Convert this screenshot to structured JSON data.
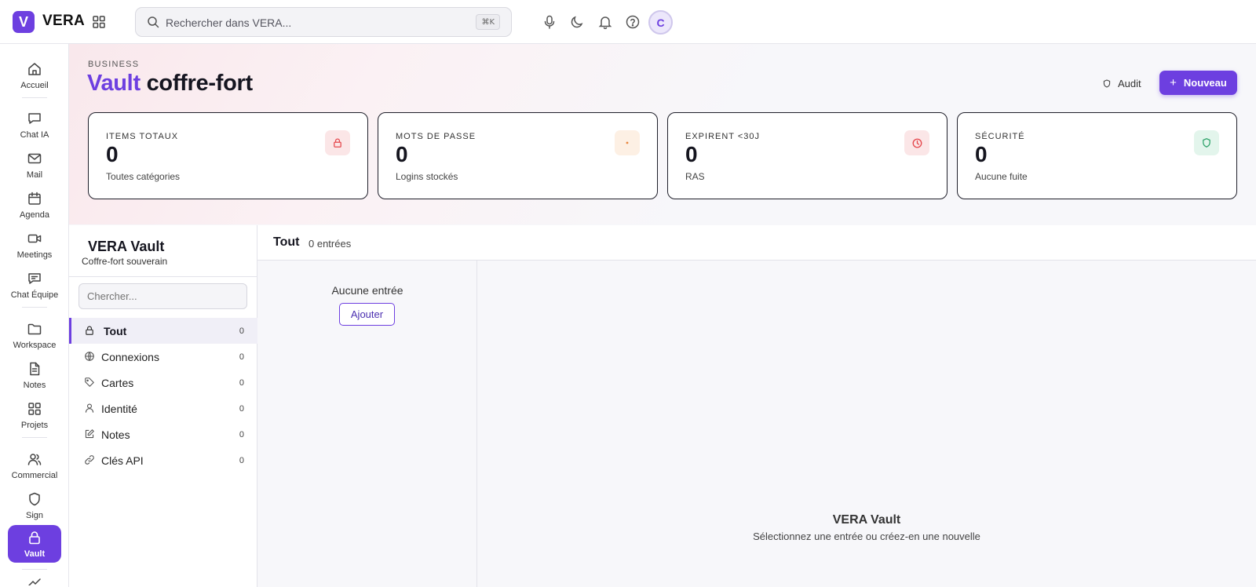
{
  "app": {
    "logo_letter": "V",
    "name": "VERA"
  },
  "search": {
    "placeholder": "Rechercher dans VERA...",
    "shortcut": "⌘K"
  },
  "user": {
    "initial": "C"
  },
  "rail": {
    "items": [
      {
        "label": "Accueil",
        "icon": "home-icon"
      },
      {
        "label": "Chat IA",
        "icon": "chat-icon"
      },
      {
        "label": "Mail",
        "icon": "mail-icon"
      },
      {
        "label": "Agenda",
        "icon": "calendar-icon"
      },
      {
        "label": "Meetings",
        "icon": "video-icon"
      },
      {
        "label": "Chat Équipe",
        "icon": "team-chat-icon"
      },
      {
        "label": "Workspace",
        "icon": "folder-icon"
      },
      {
        "label": "Notes",
        "icon": "file-icon"
      },
      {
        "label": "Projets",
        "icon": "grid-icon"
      },
      {
        "label": "Commercial",
        "icon": "users-icon"
      },
      {
        "label": "Sign",
        "icon": "shield-icon"
      },
      {
        "label": "Vault",
        "icon": "lock-icon"
      }
    ],
    "active": "Vault"
  },
  "header": {
    "eyebrow": "BUSINESS",
    "title_accent": "Vault",
    "title_rest": "coffre-fort",
    "audit_label": "Audit",
    "new_label": "Nouveau"
  },
  "stats": [
    {
      "label": "ITEMS TOTAUX",
      "value": "0",
      "sub": "Toutes catégories",
      "icon": "lock-icon",
      "color": "#e5484d"
    },
    {
      "label": "MOTS DE PASSE",
      "value": "0",
      "sub": "Logins stockés",
      "icon": "dot-icon",
      "color": "#e8853d"
    },
    {
      "label": "EXPIRENT <30J",
      "value": "0",
      "sub": "RAS",
      "icon": "clock-icon",
      "color": "#e5484d"
    },
    {
      "label": "SÉCURITÉ",
      "value": "0",
      "sub": "Aucune fuite",
      "icon": "shield-icon",
      "color": "#2fa36b"
    }
  ],
  "vault": {
    "title": "VERA Vault",
    "subtitle": "Coffre-fort souverain",
    "search_placeholder": "Chercher...",
    "categories": [
      {
        "label": "Tout",
        "count": "0",
        "icon": "lock-icon"
      },
      {
        "label": "Connexions",
        "count": "0",
        "icon": "globe-icon"
      },
      {
        "label": "Cartes",
        "count": "0",
        "icon": "tag-icon"
      },
      {
        "label": "Identité",
        "count": "0",
        "icon": "user-icon"
      },
      {
        "label": "Notes",
        "count": "0",
        "icon": "edit-icon"
      },
      {
        "label": "Clés API",
        "count": "0",
        "icon": "link-icon"
      }
    ]
  },
  "list": {
    "title": "Tout",
    "count_label": "0 entrées",
    "empty_label": "Aucune entrée",
    "add_label": "Ajouter"
  },
  "detail": {
    "title": "VERA Vault",
    "subtitle": "Sélectionnez une entrée ou créez-en une nouvelle"
  },
  "colors": {
    "accent": "#6d3fe0",
    "danger": "#e5484d",
    "warning": "#e8853d",
    "success": "#2fa36b"
  }
}
